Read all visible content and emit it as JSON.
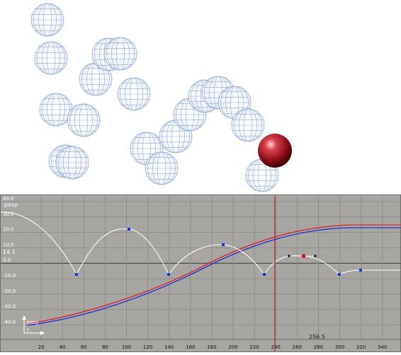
{
  "viewport": {
    "ghost_color": "#7f9ad6",
    "ball_color": "#b3202e"
  },
  "graph_editor": {
    "background": "#a8a6a3",
    "curve_label": "posy",
    "value_label": "14.1",
    "current_frame_value": "256.5",
    "axis_gizmo": {
      "y_label": "posy",
      "x_label": "t"
    },
    "y_ticks": [
      "40.0",
      "30.0",
      "20.0",
      "10.0",
      "0.0",
      "-10.0",
      "-20.0",
      "-30.0",
      "-40.0"
    ],
    "x_ticks": [
      "20",
      "40",
      "60",
      "80",
      "100",
      "120",
      "140",
      "160",
      "180",
      "200",
      "220",
      "240",
      "260",
      "280",
      "300",
      "320",
      "340"
    ],
    "colors": {
      "bounce_curve": "#ffffff",
      "curve_red": "#d82020",
      "curve_blue": "#2030d8",
      "playhead": "#c01818",
      "key": "#1838e0",
      "selected_key": "#e01010"
    }
  }
}
